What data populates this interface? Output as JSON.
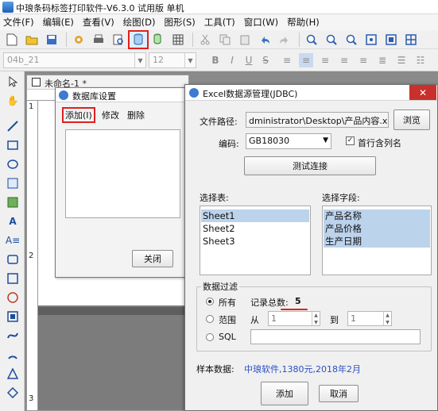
{
  "app": {
    "title": "中琅条码标签打印软件-V6.3.0 试用版 单机"
  },
  "menu": [
    "文件(F)",
    "编辑(E)",
    "查看(V)",
    "绘图(D)",
    "图形(S)",
    "工具(T)",
    "窗口(W)",
    "帮助(H)"
  ],
  "format_bar": {
    "font_value": "04b_21",
    "size_value": "12",
    "style_glyphs": [
      "B",
      "I",
      "U",
      "S"
    ]
  },
  "document": {
    "tab_title": "未命名-1 *",
    "ruler_marks": [
      "1",
      "2",
      "3"
    ]
  },
  "db_dialog": {
    "title": "数据库设置",
    "menu": {
      "add": "添加(I)",
      "edit": "修改",
      "delete": "删除"
    },
    "close_button": "关闭"
  },
  "excel_dialog": {
    "title": "Excel数据源管理(JDBC)",
    "close_glyph": "✕",
    "file_path_label": "文件路径:",
    "file_path_value": "dministrator\\Desktop\\产品内容.xlsx",
    "browse_button": "浏览",
    "encoding_label": "编码:",
    "encoding_value": "GB18030",
    "first_row_label": "首行含列名",
    "first_row_checked": true,
    "test_button": "测试连接",
    "table_label": "选择表:",
    "tables": [
      "Sheet1",
      "Sheet2",
      "Sheet3"
    ],
    "field_label": "选择字段:",
    "fields": [
      "产品名称",
      "产品价格",
      "生产日期"
    ],
    "filter_label": "数据过滤",
    "filter_all": "所有",
    "record_count_label": "记录总数:",
    "record_count": "5",
    "filter_range": "范围",
    "range_from": "从",
    "range_from_value": "1",
    "range_to": "到",
    "range_to_value": "1",
    "filter_sql": "SQL",
    "sample_label": "样本数据:",
    "sample_value": "中琅软件,1380元,2018年2月",
    "add_button": "添加",
    "cancel_button": "取消"
  },
  "colors": {
    "highlight": "#e02020",
    "selection": "#bcd3ec",
    "link_text": "#2a4fc0"
  }
}
